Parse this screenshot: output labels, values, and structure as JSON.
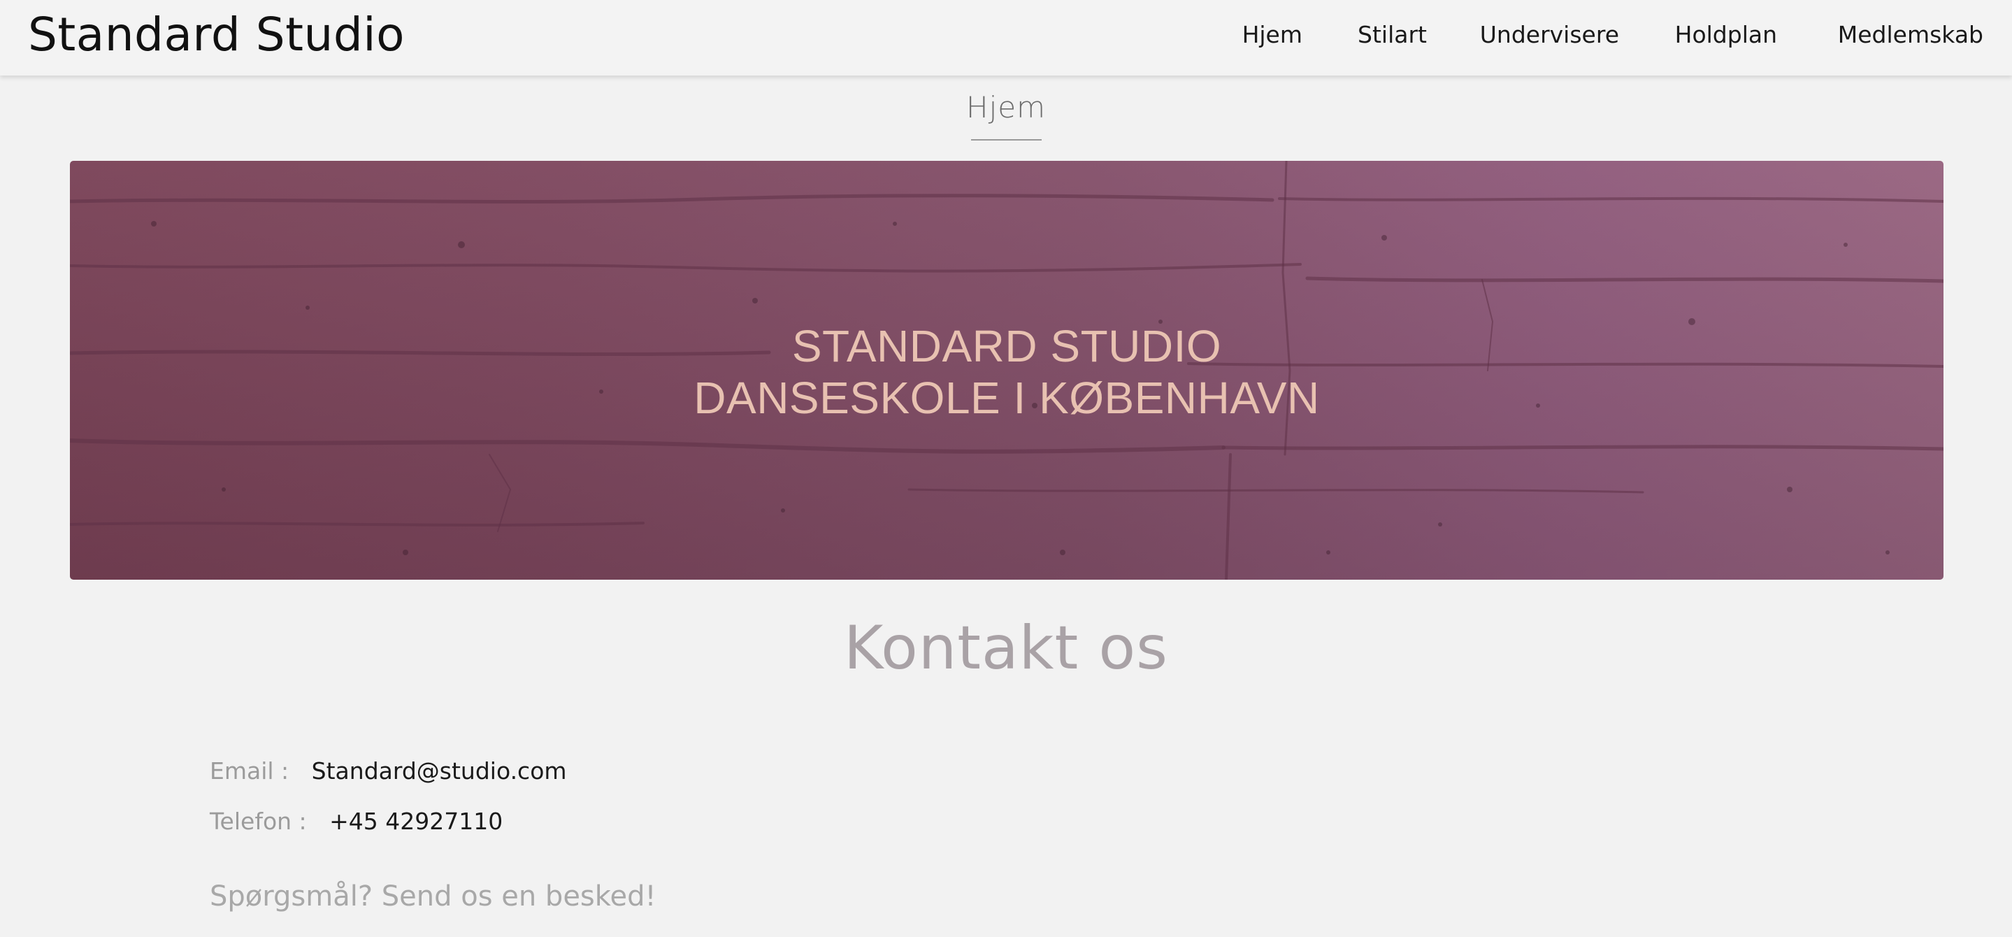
{
  "header": {
    "brand": "Standard Studio",
    "nav": [
      "Hjem",
      "Stilart",
      "Undervisere",
      "Holdplan",
      "Medlemskab"
    ]
  },
  "page": {
    "heading": "Hjem"
  },
  "hero": {
    "line1": "STANDARD STUDIO",
    "line2": "DANSESKOLE I KØBENHAVN",
    "accent_text_color": "#e8c1b1",
    "background_color": "#84506a"
  },
  "contact": {
    "title": "Kontakt os",
    "email_label": "Email :",
    "email_value": "Standard@studio.com",
    "phone_label": "Telefon :",
    "phone_value": "+45 42927110",
    "cta": "Spørgsmål? Send os en besked!"
  }
}
